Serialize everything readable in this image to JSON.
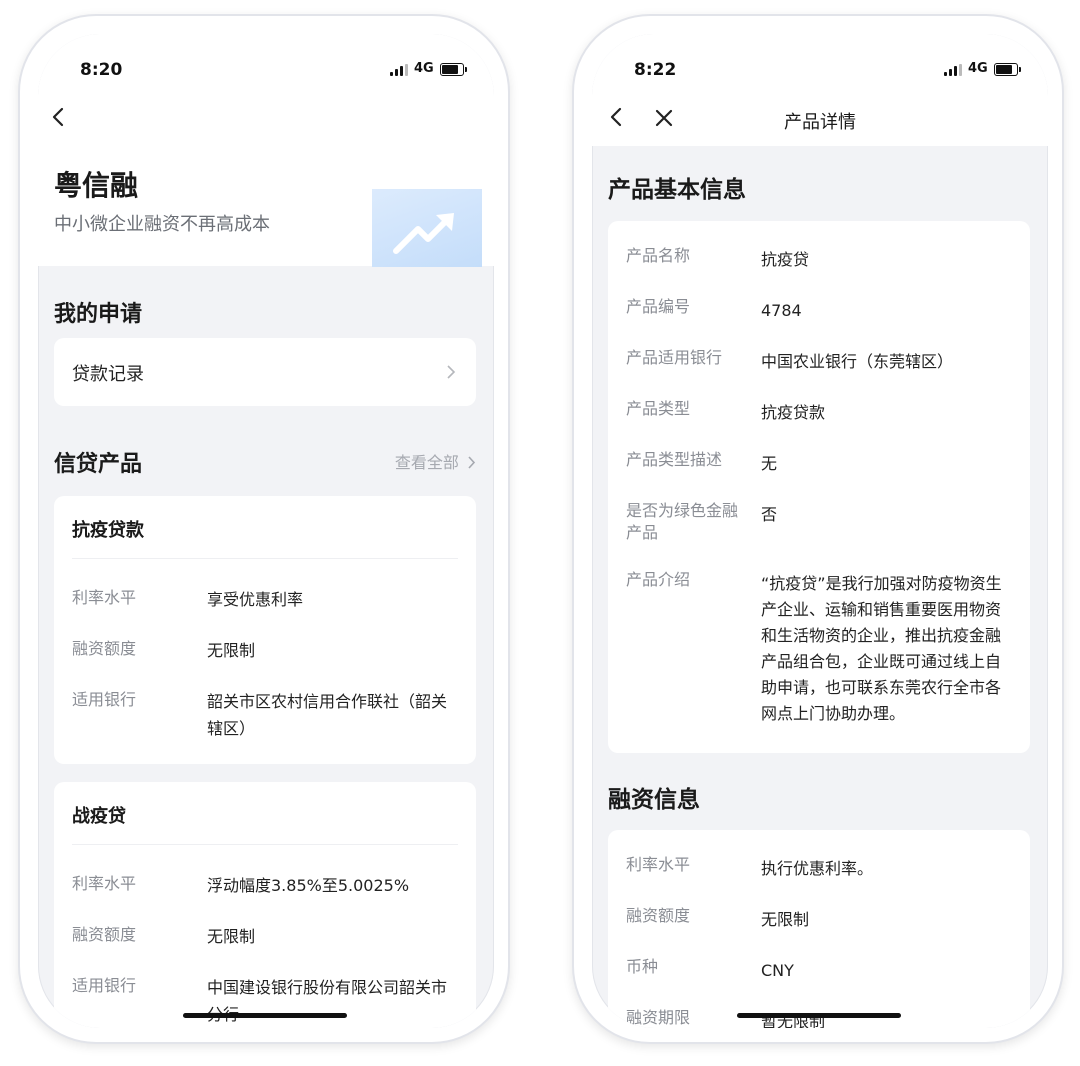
{
  "left": {
    "status": {
      "time": "8:20",
      "network": "4G"
    },
    "header": {
      "title": "粤信融",
      "subtitle": "中小微企业融资不再高成本"
    },
    "my_applications": {
      "title": "我的申请",
      "loan_records_label": "贷款记录"
    },
    "credit_products": {
      "title": "信贷产品",
      "view_all": "查看全部",
      "products": [
        {
          "name": "抗疫贷款",
          "fields": [
            {
              "label": "利率水平",
              "value": "享受优惠利率"
            },
            {
              "label": "融资额度",
              "value": "无限制"
            },
            {
              "label": "适用银行",
              "value": "韶关市区农村信用合作联社（韶关辖区）"
            }
          ]
        },
        {
          "name": "战疫贷",
          "fields": [
            {
              "label": "利率水平",
              "value": "浮动幅度3.85%至5.0025%"
            },
            {
              "label": "融资额度",
              "value": "无限制"
            },
            {
              "label": "适用银行",
              "value": "中国建设银行股份有限公司韶关市分行"
            }
          ]
        }
      ]
    }
  },
  "right": {
    "status": {
      "time": "8:22",
      "network": "4G"
    },
    "nav": {
      "title": "产品详情"
    },
    "basic_info": {
      "title": "产品基本信息",
      "fields": [
        {
          "label": "产品名称",
          "value": "抗疫贷"
        },
        {
          "label": "产品编号",
          "value": "4784"
        },
        {
          "label": "产品适用银行",
          "value": "中国农业银行（东莞辖区）"
        },
        {
          "label": "产品类型",
          "value": "抗疫贷款"
        },
        {
          "label": "产品类型描述",
          "value": "无"
        },
        {
          "label": "是否为绿色金融产品",
          "value": "否"
        },
        {
          "label": "产品介绍",
          "value": "“抗疫贷”是我行加强对防疫物资生产企业、运输和销售重要医用物资和生活物资的企业，推出抗疫金融产品组合包，企业既可通过线上自助申请，也可联系东莞农行全市各网点上门协助办理。"
        }
      ]
    },
    "financing_info": {
      "title": "融资信息",
      "fields": [
        {
          "label": "利率水平",
          "value": "执行优惠利率。"
        },
        {
          "label": "融资额度",
          "value": "无限制"
        },
        {
          "label": "币种",
          "value": "CNY"
        },
        {
          "label": "融资期限",
          "value": "暂无限制"
        }
      ]
    }
  }
}
